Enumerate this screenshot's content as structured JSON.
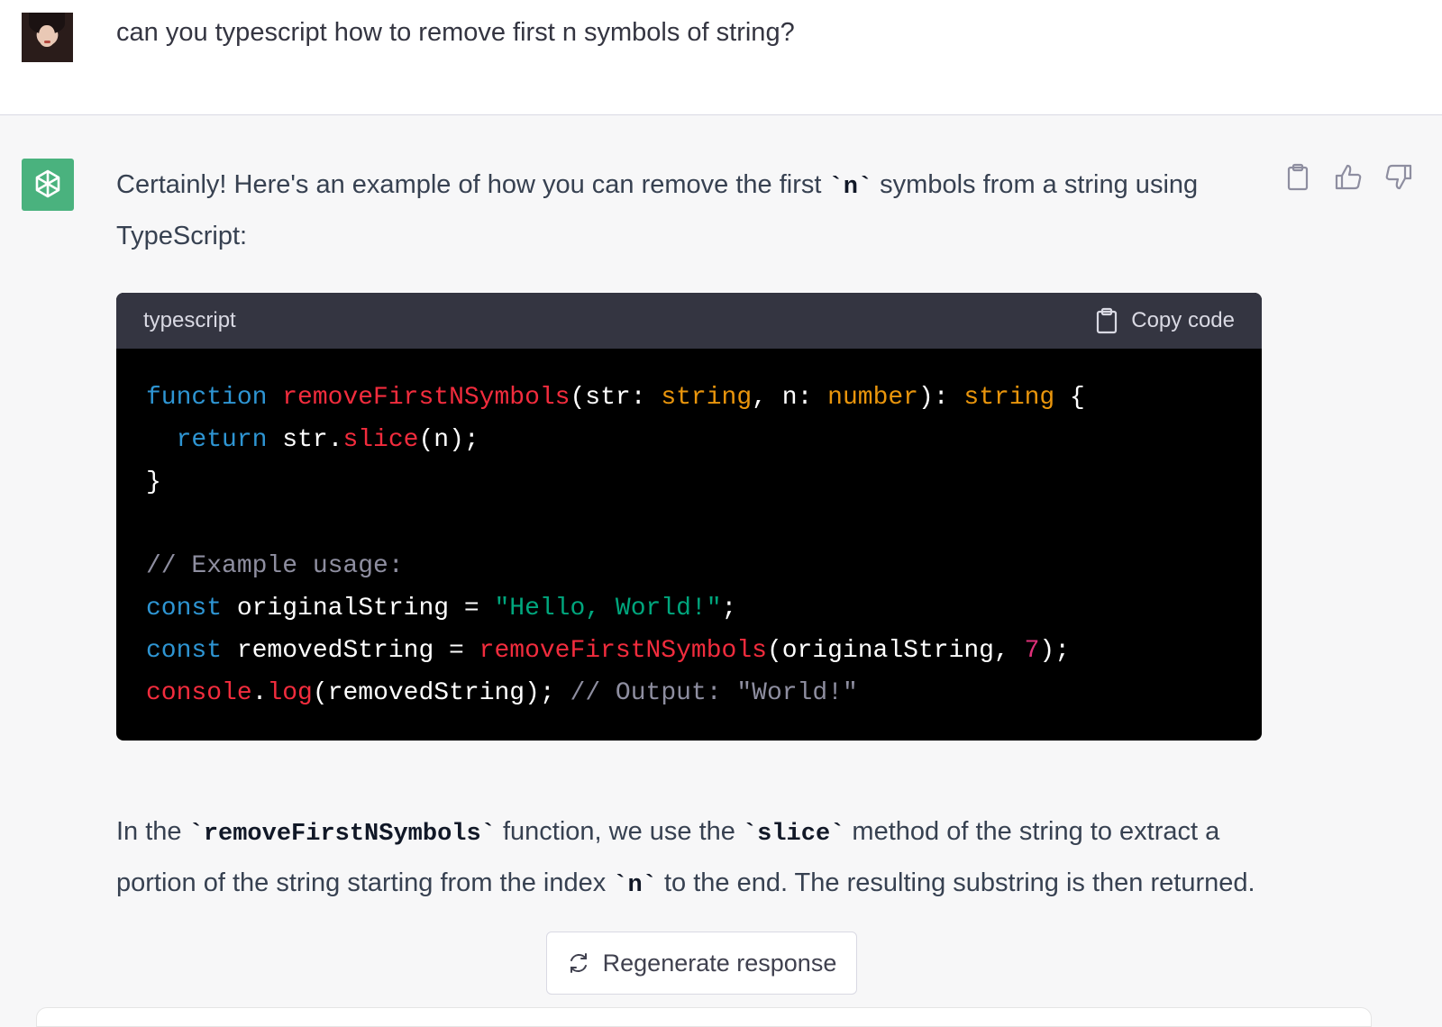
{
  "user_message": {
    "text": "can you typescript how to remove first n symbols of string?"
  },
  "assistant": {
    "intro": {
      "before": "Certainly! Here's an example of how you can remove the first ",
      "code": "`n`",
      "after": " symbols from a string using TypeScript:"
    },
    "code_block": {
      "language": "typescript",
      "copy_label": "Copy code",
      "lines": [
        [
          {
            "t": "function",
            "c": "keyword"
          },
          {
            "t": " ",
            "c": "plain"
          },
          {
            "t": "removeFirstNSymbols",
            "c": "fn"
          },
          {
            "t": "(str: ",
            "c": "plain"
          },
          {
            "t": "string",
            "c": "type"
          },
          {
            "t": ", n: ",
            "c": "plain"
          },
          {
            "t": "number",
            "c": "type"
          },
          {
            "t": "): ",
            "c": "plain"
          },
          {
            "t": "string",
            "c": "type"
          },
          {
            "t": " {",
            "c": "plain"
          }
        ],
        [
          {
            "t": "  ",
            "c": "plain"
          },
          {
            "t": "return",
            "c": "keyword"
          },
          {
            "t": " str.",
            "c": "plain"
          },
          {
            "t": "slice",
            "c": "fn"
          },
          {
            "t": "(n);",
            "c": "plain"
          }
        ],
        [
          {
            "t": "}",
            "c": "plain"
          }
        ],
        [],
        [
          {
            "t": "// Example usage:",
            "c": "comment"
          }
        ],
        [
          {
            "t": "const",
            "c": "keyword"
          },
          {
            "t": " originalString = ",
            "c": "plain"
          },
          {
            "t": "\"Hello, World!\"",
            "c": "str"
          },
          {
            "t": ";",
            "c": "plain"
          }
        ],
        [
          {
            "t": "const",
            "c": "keyword"
          },
          {
            "t": " removedString = ",
            "c": "plain"
          },
          {
            "t": "removeFirstNSymbols",
            "c": "fn"
          },
          {
            "t": "(originalString, ",
            "c": "plain"
          },
          {
            "t": "7",
            "c": "num"
          },
          {
            "t": ");",
            "c": "plain"
          }
        ],
        [
          {
            "t": "console",
            "c": "fn"
          },
          {
            "t": ".",
            "c": "plain"
          },
          {
            "t": "log",
            "c": "fn"
          },
          {
            "t": "(removedString); ",
            "c": "plain"
          },
          {
            "t": "// Output: \"World!\"",
            "c": "comment"
          }
        ]
      ]
    },
    "explanation": {
      "p1": "In the ",
      "code1": "`removeFirstNSymbols`",
      "p2": " function, we use the ",
      "code2": "`slice`",
      "p3": " method of the string to extract a portion of the string starting from the index ",
      "code3": "`n`",
      "p4": " to the end. The resulting substring is then returned."
    }
  },
  "actions": {
    "icons": [
      "clipboard-icon",
      "thumbs-up-icon",
      "thumbs-down-icon"
    ]
  },
  "regenerate": {
    "label": "Regenerate response"
  },
  "colors": {
    "bot_avatar": "#4ab27e",
    "code_bg": "#000000",
    "code_header_bg": "#343541",
    "keyword": "#2e95d3",
    "function": "#f22c3d",
    "type": "#e9950c",
    "string": "#00a67d",
    "number": "#df3079",
    "comment": "#8e8ea0"
  }
}
